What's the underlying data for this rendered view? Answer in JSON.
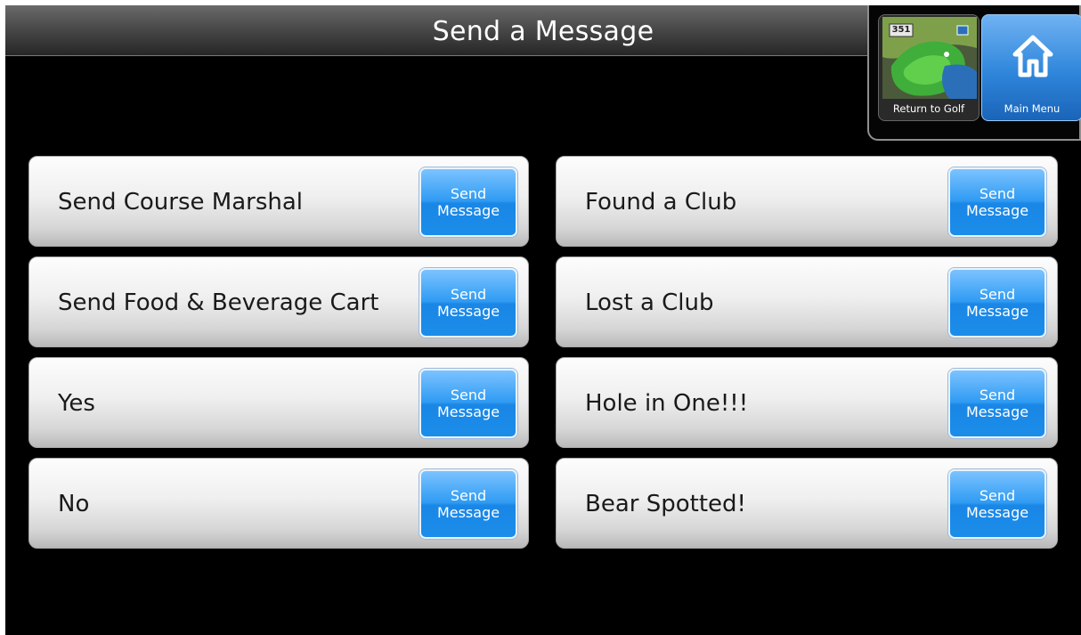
{
  "header": {
    "title": "Send a Message"
  },
  "nav": {
    "return_label": "Return to Golf",
    "return_hole_number": "351",
    "main_menu_label": "Main Menu"
  },
  "send_button": {
    "line1": "Send",
    "line2": "Message"
  },
  "messages": {
    "left": [
      {
        "label": "Send Course Marshal"
      },
      {
        "label": "Send Food & Beverage Cart"
      },
      {
        "label": "Yes"
      },
      {
        "label": "No"
      }
    ],
    "right": [
      {
        "label": "Found a Club"
      },
      {
        "label": "Lost a Club"
      },
      {
        "label": "Hole in One!!!"
      },
      {
        "label": "Bear Spotted!"
      }
    ]
  },
  "colors": {
    "background": "#000000",
    "send_button_blue": "#1a86e6",
    "main_menu_blue": "#2f86db",
    "row_gray": "#e6e6e6"
  }
}
